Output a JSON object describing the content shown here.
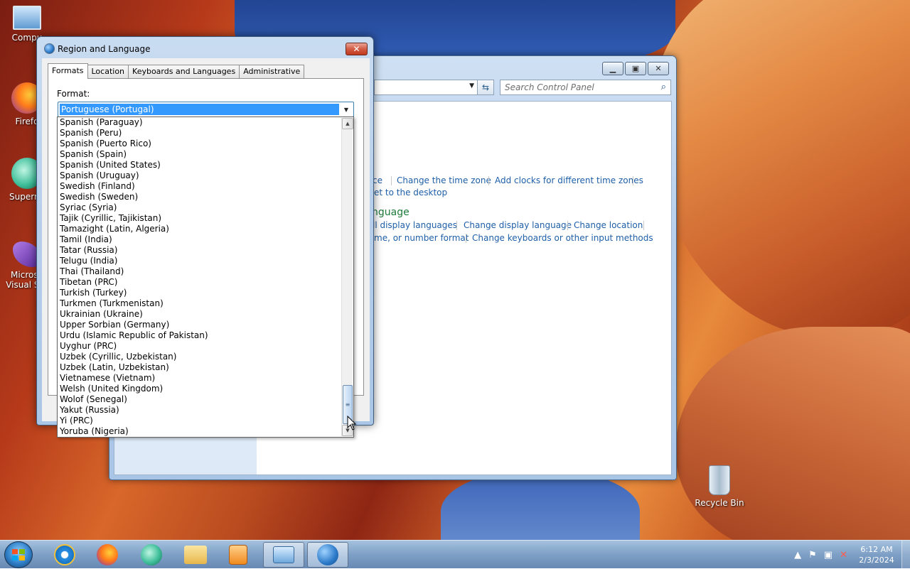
{
  "desktop": {
    "icons": [
      {
        "label": "Compu",
        "name": "computer"
      },
      {
        "label": "Firefo",
        "name": "firefox"
      },
      {
        "label": "Supermi",
        "name": "supermium"
      },
      {
        "label": "Microso",
        "label2": "Visual Stu",
        "name": "visual-studio"
      },
      {
        "label": "Recycle Bin",
        "name": "recycle-bin"
      }
    ]
  },
  "control_panel": {
    "search_placeholder": "Search Control Panel",
    "clock_links": [
      "ce",
      "Change the time zone",
      "Add clocks for different time zones"
    ],
    "clock_link2": "et to the desktop",
    "region_heading": "nguage",
    "region_links": [
      "ll display languages",
      "Change display language",
      "Change location"
    ],
    "region_links2": [
      "me, or number format",
      "Change keyboards or other input methods"
    ]
  },
  "dialog": {
    "title": "Region and Language",
    "close_symbol": "✕",
    "tabs": [
      "Formats",
      "Location",
      "Keyboards and Languages",
      "Administrative"
    ],
    "active_tab": "Formats",
    "format_label": "Format:",
    "selected_format": "Portuguese (Portugal)",
    "dropdown_items": [
      "Spanish (Paraguay)",
      "Spanish (Peru)",
      "Spanish (Puerto Rico)",
      "Spanish (Spain)",
      "Spanish (United States)",
      "Spanish (Uruguay)",
      "Swedish (Finland)",
      "Swedish (Sweden)",
      "Syriac (Syria)",
      "Tajik (Cyrillic, Tajikistan)",
      "Tamazight (Latin, Algeria)",
      "Tamil (India)",
      "Tatar (Russia)",
      "Telugu (India)",
      "Thai (Thailand)",
      "Tibetan (PRC)",
      "Turkish (Turkey)",
      "Turkmen (Turkmenistan)",
      "Ukrainian (Ukraine)",
      "Upper Sorbian (Germany)",
      "Urdu (Islamic Republic of Pakistan)",
      "Uyghur (PRC)",
      "Uzbek (Cyrillic, Uzbekistan)",
      "Uzbek (Latin, Uzbekistan)",
      "Vietnamese (Vietnam)",
      "Welsh (United Kingdom)",
      "Wolof (Senegal)",
      "Yakut (Russia)",
      "Yi (PRC)",
      "Yoruba (Nigeria)"
    ]
  },
  "taskbar": {
    "time": "6:12 AM",
    "date": "2/3/2024"
  },
  "colors": {
    "link": "#1e5fa8",
    "heading_green": "#1e7a39",
    "selection": "#3399ff"
  }
}
